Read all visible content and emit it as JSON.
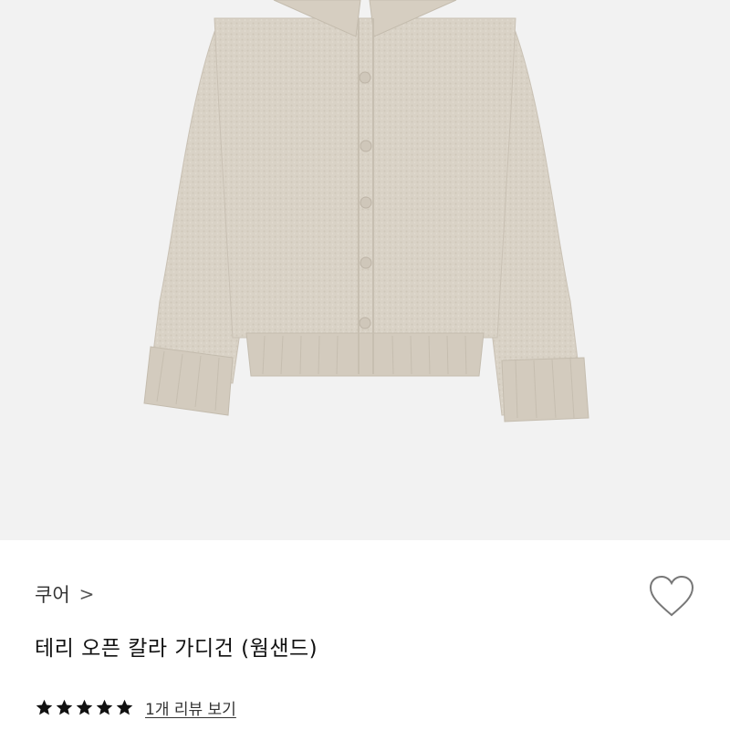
{
  "product": {
    "image_alt_description_icon": "cardigan-image",
    "brand": "쿠어",
    "brand_chevron": ">",
    "title": "테리 오픈 칼라 가디건 (웜샌드)",
    "rating": {
      "stars": 5,
      "max": 5
    },
    "review_link": "1개 리뷰 보기"
  },
  "icons": {
    "wishlist": "heart-outline-icon",
    "star": "star-icon"
  },
  "colors": {
    "garment": "#d9d2c6",
    "image_bg": "#f2f2f2",
    "star": "#111111"
  }
}
